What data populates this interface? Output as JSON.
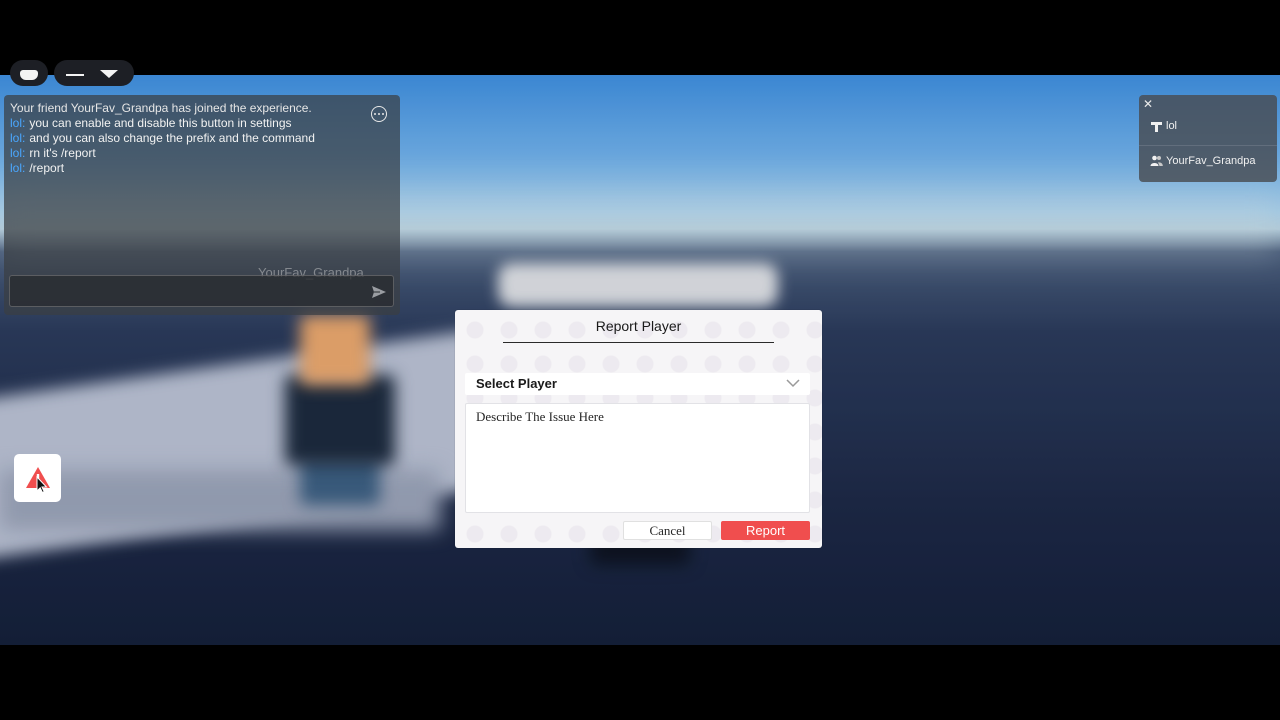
{
  "chat": {
    "system_message": "Your friend YourFav_Grandpa has joined the experience.",
    "messages": [
      {
        "prefix": "lol:",
        "text": "you can enable and disable this button in settings"
      },
      {
        "prefix": "lol:",
        "text": "and you can also change the prefix and the command"
      },
      {
        "prefix": "lol:",
        "text": "rn it's /report"
      },
      {
        "prefix": "lol:",
        "text": "/report"
      }
    ],
    "overhead_name": "YourFav_Grandpa",
    "input_value": "",
    "options_icon": "ellipsis-icon",
    "send_icon": "send-icon"
  },
  "player_list": {
    "close_label": "✕",
    "players": [
      {
        "name": "lol",
        "icon": "premium-icon"
      },
      {
        "name": "YourFav_Grandpa",
        "icon": "friends-icon"
      }
    ]
  },
  "report_launcher": {
    "icon": "warning-icon",
    "accent": "#f04e4e"
  },
  "dialog": {
    "title": "Report Player",
    "select_label": "Select Player",
    "issue_placeholder": "Describe The Issue Here",
    "cancel_label": "Cancel",
    "report_label": "Report",
    "report_color": "#f04e4e"
  }
}
